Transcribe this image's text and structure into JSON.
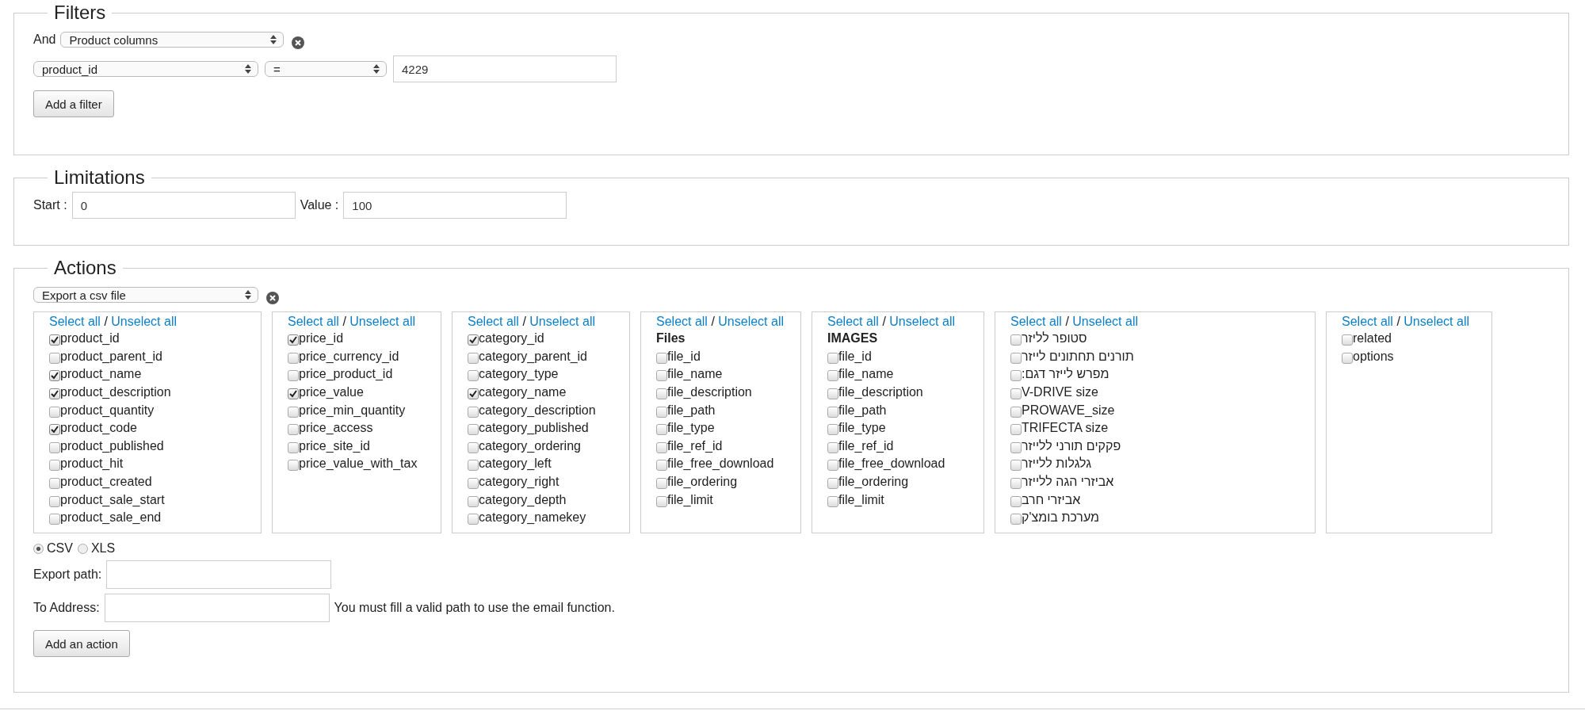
{
  "filters": {
    "legend": "Filters",
    "and_label": "And",
    "group_select": "Product columns",
    "field_select": "product_id",
    "operator_select": "=",
    "value": "4229",
    "add_button": "Add a filter"
  },
  "limitations": {
    "legend": "Limitations",
    "start_label": "Start :",
    "start_value": "0",
    "value_label": "Value :",
    "value_value": "100"
  },
  "actions": {
    "legend": "Actions",
    "action_select": "Export a csv file",
    "column_groups": [
      {
        "select_all": "Select all",
        "separator": "/",
        "unselect_all": "Unselect all",
        "items": [
          {
            "label": "product_id",
            "checked": true
          },
          {
            "label": "product_parent_id",
            "checked": false
          },
          {
            "label": "product_name",
            "checked": true
          },
          {
            "label": "product_description",
            "checked": true
          },
          {
            "label": "product_quantity",
            "checked": false
          },
          {
            "label": "product_code",
            "checked": true
          },
          {
            "label": "product_published",
            "checked": false
          },
          {
            "label": "product_hit",
            "checked": false
          },
          {
            "label": "product_created",
            "checked": false
          },
          {
            "label": "product_sale_start",
            "checked": false
          },
          {
            "label": "product_sale_end",
            "checked": false
          }
        ]
      },
      {
        "select_all": "Select all",
        "separator": "/",
        "unselect_all": "Unselect all",
        "items": [
          {
            "label": "price_id",
            "checked": true
          },
          {
            "label": "price_currency_id",
            "checked": false
          },
          {
            "label": "price_product_id",
            "checked": false
          },
          {
            "label": "price_value",
            "checked": true
          },
          {
            "label": "price_min_quantity",
            "checked": false
          },
          {
            "label": "price_access",
            "checked": false
          },
          {
            "label": "price_site_id",
            "checked": false
          },
          {
            "label": "price_value_with_tax",
            "checked": false
          }
        ]
      },
      {
        "select_all": "Select all",
        "separator": "/",
        "unselect_all": "Unselect all",
        "items": [
          {
            "label": "category_id",
            "checked": true
          },
          {
            "label": "category_parent_id",
            "checked": false
          },
          {
            "label": "category_type",
            "checked": false
          },
          {
            "label": "category_name",
            "checked": true
          },
          {
            "label": "category_description",
            "checked": false
          },
          {
            "label": "category_published",
            "checked": false
          },
          {
            "label": "category_ordering",
            "checked": false
          },
          {
            "label": "category_left",
            "checked": false
          },
          {
            "label": "category_right",
            "checked": false
          },
          {
            "label": "category_depth",
            "checked": false
          },
          {
            "label": "category_namekey",
            "checked": false
          }
        ]
      },
      {
        "select_all": "Select all",
        "separator": "/",
        "unselect_all": "Unselect all",
        "heading": "Files",
        "items": [
          {
            "label": "file_id",
            "checked": false
          },
          {
            "label": "file_name",
            "checked": false
          },
          {
            "label": "file_description",
            "checked": false
          },
          {
            "label": "file_path",
            "checked": false
          },
          {
            "label": "file_type",
            "checked": false
          },
          {
            "label": "file_ref_id",
            "checked": false
          },
          {
            "label": "file_free_download",
            "checked": false
          },
          {
            "label": "file_ordering",
            "checked": false
          },
          {
            "label": "file_limit",
            "checked": false
          }
        ]
      },
      {
        "select_all": "Select all",
        "separator": "/",
        "unselect_all": "Unselect all",
        "heading": "IMAGES",
        "items": [
          {
            "label": "file_id",
            "checked": false
          },
          {
            "label": "file_name",
            "checked": false
          },
          {
            "label": "file_description",
            "checked": false
          },
          {
            "label": "file_path",
            "checked": false
          },
          {
            "label": "file_type",
            "checked": false
          },
          {
            "label": "file_ref_id",
            "checked": false
          },
          {
            "label": "file_free_download",
            "checked": false
          },
          {
            "label": "file_ordering",
            "checked": false
          },
          {
            "label": "file_limit",
            "checked": false
          }
        ]
      },
      {
        "select_all": "Select all",
        "separator": "/",
        "unselect_all": "Unselect all",
        "items": [
          {
            "label": "סטופר לליזר",
            "checked": false
          },
          {
            "label": "תורנים תחתונים לייזר",
            "checked": false
          },
          {
            "label": "מפרש לייזר דגם:",
            "checked": false
          },
          {
            "label": "V-DRIVE size",
            "checked": false
          },
          {
            "label": "PROWAVE_size",
            "checked": false
          },
          {
            "label": "TRIFECTA size",
            "checked": false
          },
          {
            "label": "פקקים תורני ללייזר",
            "checked": false
          },
          {
            "label": "גלגלות ללייזר",
            "checked": false
          },
          {
            "label": "אביזרי הגה ללייזר",
            "checked": false
          },
          {
            "label": "אביזרי חרב",
            "checked": false
          },
          {
            "label": "מערכת בומצ'ק",
            "checked": false
          }
        ]
      },
      {
        "select_all": "Select all",
        "separator": "/",
        "unselect_all": "Unselect all",
        "items": [
          {
            "label": "related",
            "checked": false
          },
          {
            "label": "options",
            "checked": false
          }
        ]
      }
    ],
    "formats": [
      {
        "label": "CSV",
        "selected": true
      },
      {
        "label": "XLS",
        "selected": false
      }
    ],
    "export_path_label": "Export path:",
    "to_address_label": "To Address:",
    "email_note": "You must fill a valid path to use the email function.",
    "add_button": "Add an action"
  }
}
